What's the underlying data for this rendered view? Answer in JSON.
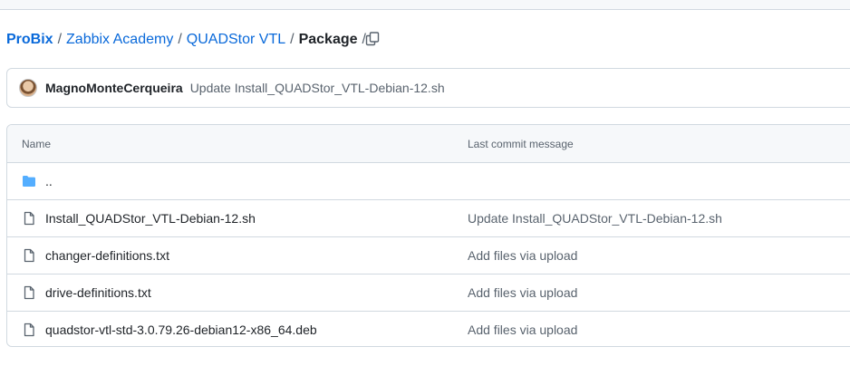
{
  "breadcrumb": {
    "owner": "ProBix",
    "path": [
      "Zabbix Academy",
      "QUADStor VTL"
    ],
    "current": "Package",
    "separator": "/"
  },
  "latest_commit": {
    "author": "MagnoMonteCerqueira",
    "message": "Update Install_QUADStor_VTL-Debian-12.sh"
  },
  "table": {
    "columns": [
      "Name",
      "Last commit message"
    ],
    "parent_dir": "..",
    "files": [
      {
        "name": "Install_QUADStor_VTL-Debian-12.sh",
        "message": "Update Install_QUADStor_VTL-Debian-12.sh"
      },
      {
        "name": "changer-definitions.txt",
        "message": "Add files via upload"
      },
      {
        "name": "drive-definitions.txt",
        "message": "Add files via upload"
      },
      {
        "name": "quadstor-vtl-std-3.0.79.26-debian12-x86_64.deb",
        "message": "Add files via upload"
      }
    ]
  },
  "colors": {
    "link": "#0969da",
    "muted": "#59636e",
    "border": "#d1d9e0",
    "folder": "#54aeff"
  },
  "icons": [
    "copy-icon",
    "avatar",
    "folder-icon",
    "file-icon"
  ]
}
